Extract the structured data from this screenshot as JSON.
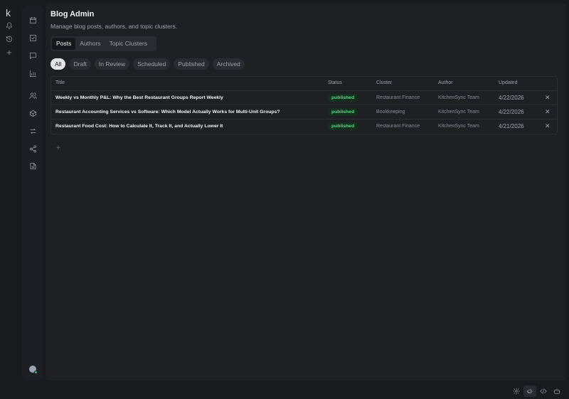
{
  "app": {
    "logo": "k"
  },
  "page": {
    "title": "Blog Admin",
    "subtitle": "Manage blog posts, authors, and topic clusters."
  },
  "tabs": [
    {
      "label": "Posts",
      "active": true
    },
    {
      "label": "Authors",
      "active": false
    },
    {
      "label": "Topic Clusters",
      "active": false
    }
  ],
  "filters": [
    {
      "label": "All",
      "active": true
    },
    {
      "label": "Draft",
      "active": false
    },
    {
      "label": "In Review",
      "active": false
    },
    {
      "label": "Scheduled",
      "active": false
    },
    {
      "label": "Published",
      "active": false
    },
    {
      "label": "Archived",
      "active": false
    }
  ],
  "table": {
    "columns": {
      "title": "Title",
      "status": "Status",
      "cluster": "Cluster",
      "author": "Author",
      "updated": "Updated"
    },
    "rows": [
      {
        "title": "Weekly vs Monthly P&L: Why the Best Restaurant Groups Report Weekly",
        "status": "published",
        "cluster": "Restaurant Finance",
        "author": "KitchenSync Team",
        "updated": "4/22/2026",
        "delete": "✕"
      },
      {
        "title": "Restaurant Accounting Services vs Software: Which Model Actually Works for Multi-Unit Groups?",
        "status": "published",
        "cluster": "Bookkeeping",
        "author": "KitchenSync Team",
        "updated": "4/22/2026",
        "delete": "✕"
      },
      {
        "title": "Restaurant Food Cost: How to Calculate It, Track It, and Actually Lower It",
        "status": "published",
        "cluster": "Restaurant Finance",
        "author": "KitchenSync Team",
        "updated": "4/21/2026",
        "delete": "✕"
      }
    ],
    "add_label": "+"
  },
  "icons": {
    "rail": [
      "bell-icon",
      "history-icon",
      "plus-icon"
    ],
    "nav": [
      "calendar-icon",
      "checkbox-icon",
      "chat-icon",
      "bar-chart-icon",
      "users-icon",
      "package-icon",
      "arrows-swap-icon",
      "share-icon",
      "document-icon"
    ],
    "bottom": [
      "gear-icon",
      "megaphone-icon",
      "code-icon",
      "robot-icon"
    ]
  },
  "colors": {
    "background": "#1a1b1e",
    "panel": "#1f2024",
    "status_published_bg": "#13301f",
    "status_published_fg": "#4ade80",
    "online": "#22c55e"
  }
}
